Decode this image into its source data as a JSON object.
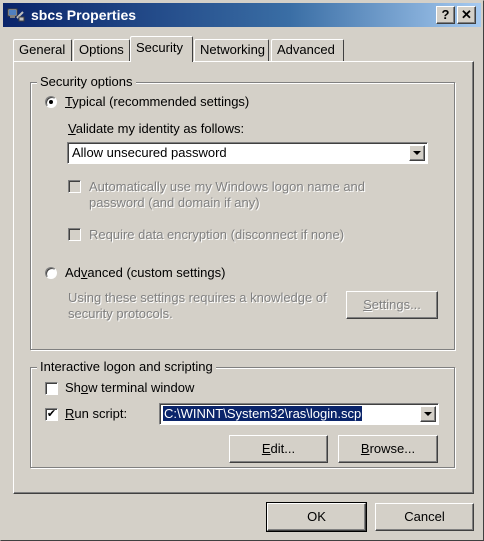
{
  "window": {
    "title": "sbcs Properties",
    "help_label": "?",
    "close_label": "✕"
  },
  "tabs": [
    {
      "label": "General"
    },
    {
      "label": "Options"
    },
    {
      "label": "Security",
      "active": true
    },
    {
      "label": "Networking"
    },
    {
      "label": "Advanced"
    }
  ],
  "security_options": {
    "legend": "Security options",
    "typical": {
      "accel": "T",
      "rest": "ypical (recommended settings)",
      "selected": true
    },
    "validate_label": {
      "accel": "V",
      "rest": "alidate my identity as follows:"
    },
    "validate_value": "Allow unsecured password",
    "auto_logon": {
      "line1": "Automatically use my Windows logon name and",
      "line2": "password (and domain if any)",
      "checked": false
    },
    "require_encryption": {
      "label": "Require data encryption (disconnect if none)",
      "checked": false
    },
    "advanced": {
      "before": "Ad",
      "accel": "v",
      "after": "anced (custom settings)",
      "selected": false
    },
    "advanced_note": {
      "line1": "Using these settings requires a knowledge of",
      "line2": "security protocols."
    },
    "settings_button": {
      "accel": "S",
      "rest": "ettings..."
    }
  },
  "interactive": {
    "legend": "Interactive logon and scripting",
    "show_terminal": {
      "before": "Sh",
      "accel": "o",
      "after": "w terminal window",
      "checked": false
    },
    "run_script": {
      "accel": "R",
      "rest": "un script:",
      "checked": true,
      "check_glyph": "✔"
    },
    "script_path": "C:\\WINNT\\System32\\ras\\login.scp",
    "edit_button": {
      "accel": "E",
      "rest": "dit..."
    },
    "browse_button": {
      "accel": "B",
      "rest": "rowse..."
    }
  },
  "footer": {
    "ok_label": "OK",
    "cancel_label": "Cancel"
  }
}
